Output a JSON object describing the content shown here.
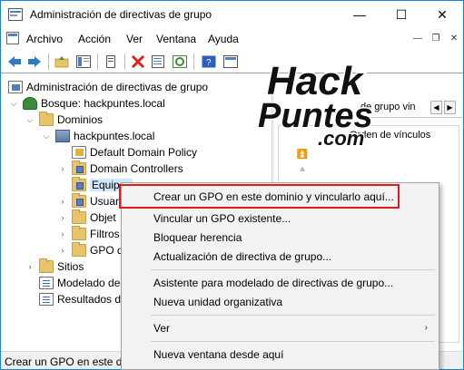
{
  "window": {
    "title": "Administración de directivas de grupo",
    "minimize": "—",
    "maximize": "☐",
    "close": "✕"
  },
  "menu": {
    "items": [
      "Archivo",
      "Acción",
      "Ver",
      "Ventana",
      "Ayuda"
    ],
    "mdi_min": "—",
    "mdi_restore": "❐",
    "mdi_close": "✕"
  },
  "tree": {
    "root": "Administración de directivas de grupo",
    "forest": "Bosque: hackpuntes.local",
    "domains": "Dominios",
    "domain": "hackpuntes.local",
    "items": [
      "Default Domain Policy",
      "Domain Controllers",
      "Equipos",
      "Usuar",
      "Objet",
      "Filtros",
      "GPO d"
    ],
    "sites": "Sitios",
    "modeling": "Modelado de",
    "results": "Resultados d"
  },
  "right_pane": {
    "tab_label": "de grupo vin",
    "tab_prev": "◀",
    "tab_next": "▶",
    "column_header": "Orden de vínculos"
  },
  "context_menu": {
    "items": [
      "Crear un GPO en este dominio y vincularlo aquí...",
      "Vincular un GPO existente...",
      "Bloquear herencia",
      "Actualización de directiva de grupo...",
      "Asistente para modelado de directivas de grupo...",
      "Nueva unidad organizativa",
      "Ver",
      "Nueva ventana desde aquí"
    ],
    "submenu_arrow": "›"
  },
  "status": {
    "text": "Crear un GPO en este do"
  },
  "logo": {
    "line1": "Hack",
    "line2": "Puntes",
    "line3": ".com"
  },
  "colors": {
    "accent_border": "#1883d7",
    "highlight_red": "#d91d1d",
    "selection": "#cce8ff"
  }
}
